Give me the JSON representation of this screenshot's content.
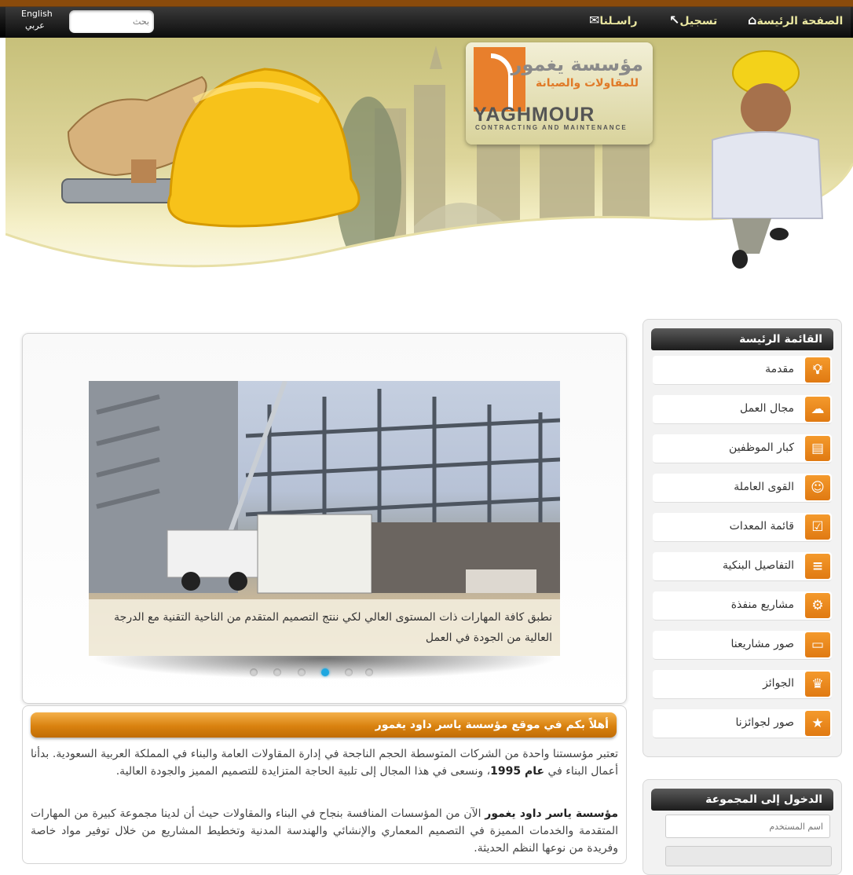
{
  "topbar": {
    "home": "الصفحة الرئيسة",
    "register": "تسجيل",
    "contact": "راسـلنا",
    "search_placeholder": "بحث",
    "lang_en": "English",
    "lang_ar": "عربي"
  },
  "logo": {
    "name_ar": "مؤسسة يغمور",
    "tagline_ar": "للمقاولات والصيانة",
    "name_en": "YAGHMOUR",
    "tagline_en": "CONTRACTING AND MAINTENANCE"
  },
  "slider": {
    "caption": "نطبق كافة المهارات ذات المستوى العالي لكي ننتج التصميم المتقدم من الناحية التقنية مع الدرجة العالية من الجودة في العمل",
    "dots": 6,
    "active_dot": 4
  },
  "article": {
    "title": "أهلاً بكم في موقع مؤسسة ياسر داود يغمور",
    "p1_a": "تعتبر مؤسستنا واحدة من الشركات المتوسطة الحجم الناجحة في إدارة المقاولات العامة والبناء في المملكة العربية السعودية. بدأنا أعمال البناء في ",
    "p1_bold": "عام 1995",
    "p1_b": "، ونسعى في هذا المجال إلى تلبية الحاجة المتزايدة للتصميم المميز والجودة العالية.",
    "p2_bold": "مؤسسة ياسر داود يغمور",
    "p2_a": " الآن من المؤسسات المنافسة بنجاح في البناء والمقاولات حيث أن لدينا مجموعة كبيرة من المهارات المتقدمة والخدمات المميزة في التصميم المعماري والإنشائي والهندسة المدنية وتخطيط المشاريع من خلال توفير مواد خاصة وفريدة من نوعها النظم الحديثة."
  },
  "main_menu": {
    "title": "القائمة الرئيسة",
    "items": [
      {
        "label": "مقدمة",
        "icon": "lightbulb-icon"
      },
      {
        "label": "مجال العمل",
        "icon": "chat-icon"
      },
      {
        "label": "كبار الموظفين",
        "icon": "id-card-icon"
      },
      {
        "label": "القوى العاملة",
        "icon": "users-icon"
      },
      {
        "label": "قائمة المعدات",
        "icon": "checklist-icon"
      },
      {
        "label": "التفاصيل البنكية",
        "icon": "bars-icon"
      },
      {
        "label": "مشاريع منفذة",
        "icon": "gear-icon"
      },
      {
        "label": "صور مشاريعنا",
        "icon": "picture-icon"
      },
      {
        "label": "الجوائز",
        "icon": "medal-icon"
      },
      {
        "label": "صور لجوائزنا",
        "icon": "stars-icon"
      }
    ]
  },
  "login": {
    "title": "الدخول إلى المجموعة",
    "username_placeholder": "اسم المستخدم"
  }
}
